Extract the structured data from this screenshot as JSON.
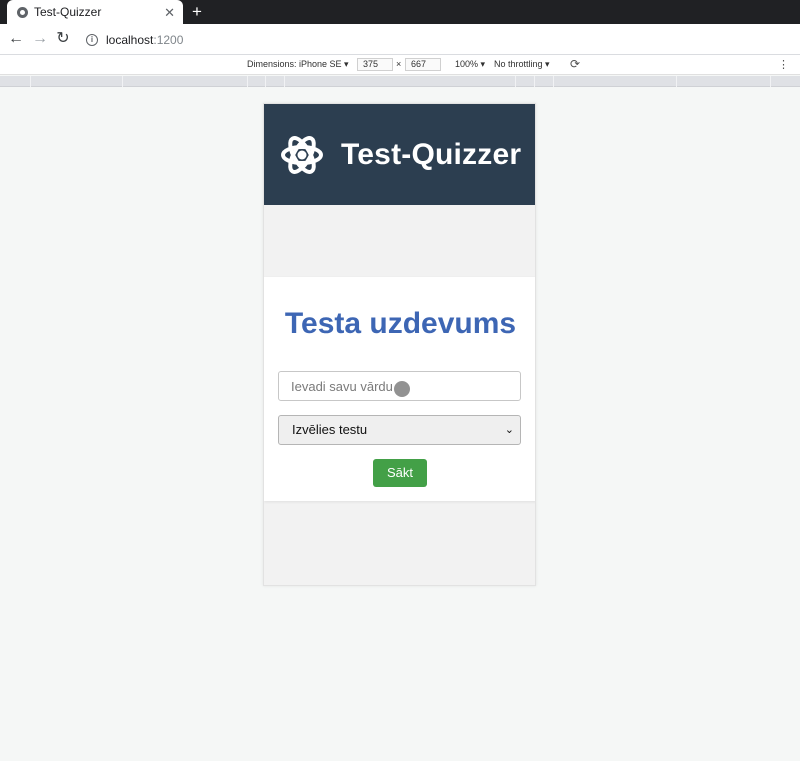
{
  "browser": {
    "tab_title": "Test-Quizzer",
    "tab_close": "✕",
    "new_tab": "+",
    "url_host": "localhost",
    "url_port": ":1200",
    "back_icon": "←",
    "forward_icon": "→",
    "reload_icon": "↻"
  },
  "devtools": {
    "dimensions_label": "Dimensions: iPhone SE ▾",
    "width": "375",
    "times": "×",
    "height": "667",
    "zoom": "100% ▾",
    "throttling": "No throttling ▾",
    "rotate_icon": "⟳",
    "more_icon": "⋮"
  },
  "app": {
    "title": "Test-Quizzer",
    "card_title": "Testa uzdevums",
    "name_placeholder": "Ievadi savu vārdu",
    "select_value": "Izvēlies testu",
    "select_chevron": "⌄",
    "start_label": "Sākt",
    "header_color": "#2c3e50",
    "title_color": "#3d66b4",
    "button_color": "#43a047"
  }
}
